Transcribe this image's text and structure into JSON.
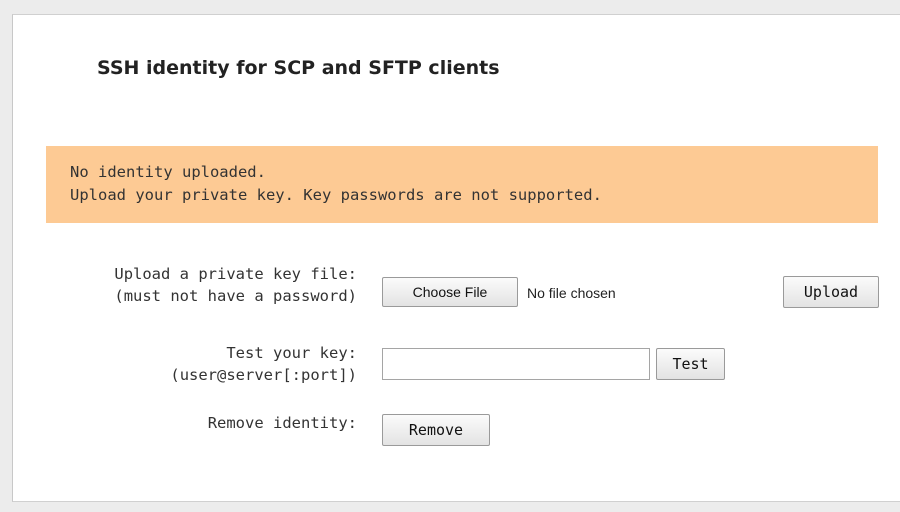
{
  "section": {
    "title": "SSH identity for SCP and SFTP clients"
  },
  "alert": {
    "line1": "No identity uploaded.",
    "line2": "Upload your private key. Key passwords are not supported."
  },
  "upload_row": {
    "label_line1": "Upload a private key file:",
    "label_line2": "(must not have a password)",
    "choose_file_label": "Choose File",
    "file_status": "No file chosen",
    "upload_button": "Upload"
  },
  "test_row": {
    "label_line1": "Test your key:",
    "label_line2": "(user@server[:port])",
    "input_value": "",
    "test_button": "Test"
  },
  "remove_row": {
    "label": "Remove identity:",
    "remove_button": "Remove"
  },
  "colors": {
    "alert_background": "#fdca94",
    "panel_background": "#ffffff",
    "page_background": "#ececec"
  }
}
